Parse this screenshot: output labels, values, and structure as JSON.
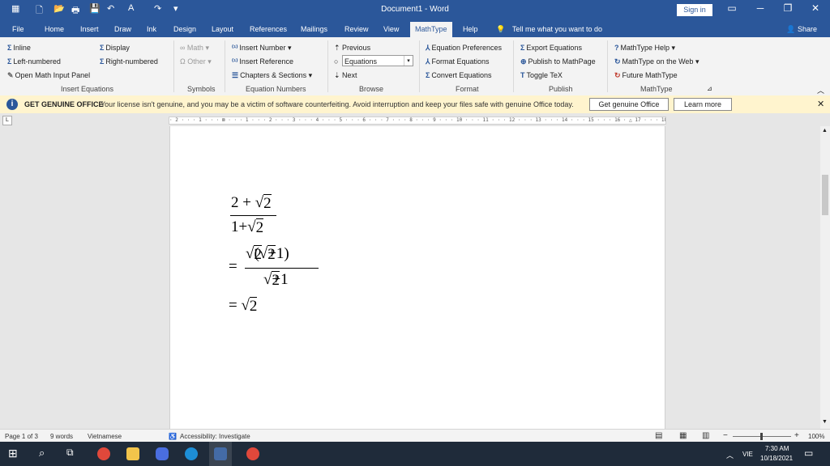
{
  "titlebar": {
    "title": "Document1 - Word",
    "sign_in": "Sign in"
  },
  "tabs": [
    "File",
    "Home",
    "Insert",
    "Draw",
    "Ink",
    "Design",
    "Layout",
    "References",
    "Mailings",
    "Review",
    "View",
    "MathType",
    "Help"
  ],
  "tell_me": "Tell me what you want to do",
  "share": "Share",
  "ribbon": {
    "insert_equations": {
      "inline": "Inline",
      "display": "Display",
      "left_numbered": "Left-numbered",
      "right_numbered": "Right-numbered",
      "open_math_input": "Open Math Input Panel",
      "group": "Insert Equations"
    },
    "symbols": {
      "math": "Math",
      "other": "Other",
      "group": "Symbols"
    },
    "equation_numbers": {
      "insert_number": "Insert Number",
      "insert_reference": "Insert Reference",
      "chapters_sections": "Chapters & Sections",
      "group": "Equation Numbers"
    },
    "browse": {
      "previous": "Previous",
      "selected": "Equations",
      "next": "Next",
      "group": "Browse"
    },
    "format": {
      "equation_preferences": "Equation Preferences",
      "format_equations": "Format Equations",
      "convert_equations": "Convert Equations",
      "group": "Format"
    },
    "publish": {
      "export_equations": "Export Equations",
      "publish_mathpage": "Publish to MathPage",
      "toggle_tex": "Toggle TeX",
      "group": "Publish"
    },
    "mathtype": {
      "help": "MathType Help",
      "web": "MathType on the Web",
      "future": "Future MathType",
      "group": "MathType"
    }
  },
  "infobar": {
    "title": "GET GENUINE OFFICE",
    "message": "Your license isn't genuine, and you may be a victim of software counterfeiting. Avoid interruption and keep your files safe with genuine Office today.",
    "get_button": "Get genuine Office",
    "learn_button": "Learn more"
  },
  "ruler_text": "· 2 · · · 1 · · · ⊠ · · · 1 · · · 2 · · · 3 · · · 4 · · · 5 · · · 6 · · · 7 · · · 8 · · · 9 · · · 10 · · · 11 · · · 12 · · · 13 · · · 14 · · · 15 · · · 16 · △ 17 · · · 18 · · · 19",
  "equation": {
    "num1": "2 + ",
    "sqrt_arg": "2",
    "den1": "1+",
    "eq": "=",
    "num2_a": "2",
    "num2_b": "2",
    "num2_paren": "(",
    "num2_close": "+1)",
    "den2_b": "+1",
    "result": "2"
  },
  "statusbar": {
    "page": "Page 1 of 3",
    "words": "9 words",
    "language": "Vietnamese",
    "accessibility": "Accessibility: Investigate",
    "zoom": "100%"
  },
  "taskbar": {
    "lang": "VIE",
    "time": "7:30 AM",
    "date": "10/18/2021"
  },
  "colors": {
    "word_blue": "#2b579a",
    "info_yellow": "#fff4ce"
  }
}
